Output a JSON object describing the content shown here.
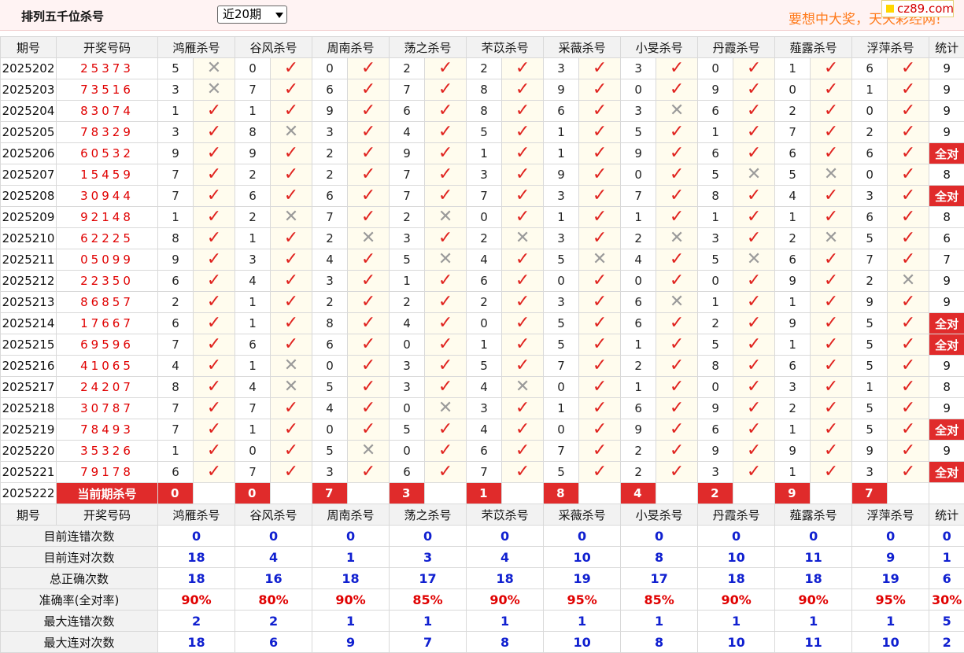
{
  "header": {
    "title": "排列五千位杀号",
    "period_select": "近20期",
    "slogan": "要想中大奖，天天彩经网!",
    "logo_text": "cz89.com"
  },
  "columns": {
    "issue": "期号",
    "draw": "开奖号码",
    "experts": [
      "鸿雁杀号",
      "谷风杀号",
      "周南杀号",
      "荡之杀号",
      "芣苡杀号",
      "采薇杀号",
      "小旻杀号",
      "丹霞杀号",
      "薤露杀号",
      "浮萍杀号"
    ],
    "total": "统计"
  },
  "rows": [
    {
      "issue": "2025202",
      "draw": "25373",
      "kills": [
        5,
        0,
        0,
        2,
        2,
        3,
        3,
        0,
        1,
        6
      ],
      "hits": [
        0,
        1,
        1,
        1,
        1,
        1,
        1,
        1,
        1,
        1
      ],
      "total": "9"
    },
    {
      "issue": "2025203",
      "draw": "73516",
      "kills": [
        3,
        7,
        6,
        7,
        8,
        9,
        0,
        9,
        0,
        1
      ],
      "hits": [
        0,
        1,
        1,
        1,
        1,
        1,
        1,
        1,
        1,
        1
      ],
      "total": "9"
    },
    {
      "issue": "2025204",
      "draw": "83074",
      "kills": [
        1,
        1,
        9,
        6,
        8,
        6,
        3,
        6,
        2,
        0
      ],
      "hits": [
        1,
        1,
        1,
        1,
        1,
        1,
        0,
        1,
        1,
        1
      ],
      "total": "9"
    },
    {
      "issue": "2025205",
      "draw": "78329",
      "kills": [
        3,
        8,
        3,
        4,
        5,
        1,
        5,
        1,
        7,
        2
      ],
      "hits": [
        1,
        0,
        1,
        1,
        1,
        1,
        1,
        1,
        1,
        1
      ],
      "total": "9"
    },
    {
      "issue": "2025206",
      "draw": "60532",
      "kills": [
        9,
        9,
        2,
        9,
        1,
        1,
        9,
        6,
        6,
        6
      ],
      "hits": [
        1,
        1,
        1,
        1,
        1,
        1,
        1,
        1,
        1,
        1
      ],
      "total": "全对"
    },
    {
      "issue": "2025207",
      "draw": "15459",
      "kills": [
        7,
        2,
        2,
        7,
        3,
        9,
        0,
        5,
        5,
        0
      ],
      "hits": [
        1,
        1,
        1,
        1,
        1,
        1,
        1,
        0,
        0,
        1
      ],
      "total": "8"
    },
    {
      "issue": "2025208",
      "draw": "30944",
      "kills": [
        7,
        6,
        6,
        7,
        7,
        3,
        7,
        8,
        4,
        3
      ],
      "hits": [
        1,
        1,
        1,
        1,
        1,
        1,
        1,
        1,
        1,
        1
      ],
      "total": "全对"
    },
    {
      "issue": "2025209",
      "draw": "92148",
      "kills": [
        1,
        2,
        7,
        2,
        0,
        1,
        1,
        1,
        1,
        6
      ],
      "hits": [
        1,
        0,
        1,
        0,
        1,
        1,
        1,
        1,
        1,
        1
      ],
      "total": "8"
    },
    {
      "issue": "2025210",
      "draw": "62225",
      "kills": [
        8,
        1,
        2,
        3,
        2,
        3,
        2,
        3,
        2,
        5
      ],
      "hits": [
        1,
        1,
        0,
        1,
        0,
        1,
        0,
        1,
        0,
        1
      ],
      "total": "6"
    },
    {
      "issue": "2025211",
      "draw": "05099",
      "kills": [
        9,
        3,
        4,
        5,
        4,
        5,
        4,
        5,
        6,
        7
      ],
      "hits": [
        1,
        1,
        1,
        0,
        1,
        0,
        1,
        0,
        1,
        1
      ],
      "total": "7"
    },
    {
      "issue": "2025212",
      "draw": "22350",
      "kills": [
        6,
        4,
        3,
        1,
        6,
        0,
        0,
        0,
        9,
        2
      ],
      "hits": [
        1,
        1,
        1,
        1,
        1,
        1,
        1,
        1,
        1,
        0
      ],
      "total": "9"
    },
    {
      "issue": "2025213",
      "draw": "86857",
      "kills": [
        2,
        1,
        2,
        2,
        2,
        3,
        6,
        1,
        1,
        9
      ],
      "hits": [
        1,
        1,
        1,
        1,
        1,
        1,
        0,
        1,
        1,
        1
      ],
      "total": "9"
    },
    {
      "issue": "2025214",
      "draw": "17667",
      "kills": [
        6,
        1,
        8,
        4,
        0,
        5,
        6,
        2,
        9,
        5
      ],
      "hits": [
        1,
        1,
        1,
        1,
        1,
        1,
        1,
        1,
        1,
        1
      ],
      "total": "全对"
    },
    {
      "issue": "2025215",
      "draw": "69596",
      "kills": [
        7,
        6,
        6,
        0,
        1,
        5,
        1,
        5,
        1,
        5
      ],
      "hits": [
        1,
        1,
        1,
        1,
        1,
        1,
        1,
        1,
        1,
        1
      ],
      "total": "全对"
    },
    {
      "issue": "2025216",
      "draw": "41065",
      "kills": [
        4,
        1,
        0,
        3,
        5,
        7,
        2,
        8,
        6,
        5
      ],
      "hits": [
        1,
        0,
        1,
        1,
        1,
        1,
        1,
        1,
        1,
        1
      ],
      "total": "9"
    },
    {
      "issue": "2025217",
      "draw": "24207",
      "kills": [
        8,
        4,
        5,
        3,
        4,
        0,
        1,
        0,
        3,
        1
      ],
      "hits": [
        1,
        0,
        1,
        1,
        0,
        1,
        1,
        1,
        1,
        1
      ],
      "total": "8"
    },
    {
      "issue": "2025218",
      "draw": "30787",
      "kills": [
        7,
        7,
        4,
        0,
        3,
        1,
        6,
        9,
        2,
        5
      ],
      "hits": [
        1,
        1,
        1,
        0,
        1,
        1,
        1,
        1,
        1,
        1
      ],
      "total": "9"
    },
    {
      "issue": "2025219",
      "draw": "78493",
      "kills": [
        7,
        1,
        0,
        5,
        4,
        0,
        9,
        6,
        1,
        5
      ],
      "hits": [
        1,
        1,
        1,
        1,
        1,
        1,
        1,
        1,
        1,
        1
      ],
      "total": "全对"
    },
    {
      "issue": "2025220",
      "draw": "35326",
      "kills": [
        1,
        0,
        5,
        0,
        6,
        7,
        2,
        9,
        9,
        9
      ],
      "hits": [
        1,
        1,
        0,
        1,
        1,
        1,
        1,
        1,
        1,
        1
      ],
      "total": "9"
    },
    {
      "issue": "2025221",
      "draw": "79178",
      "kills": [
        6,
        7,
        3,
        6,
        7,
        5,
        2,
        3,
        1,
        3
      ],
      "hits": [
        1,
        1,
        1,
        1,
        1,
        1,
        1,
        1,
        1,
        1
      ],
      "total": "全对"
    }
  ],
  "current": {
    "issue": "2025222",
    "label": "当前期杀号",
    "kills": [
      0,
      0,
      7,
      3,
      1,
      8,
      4,
      2,
      9,
      7
    ]
  },
  "stats": [
    {
      "label": "目前连错次数",
      "values": [
        "0",
        "0",
        "0",
        "0",
        "0",
        "0",
        "0",
        "0",
        "0",
        "0"
      ],
      "total": "0"
    },
    {
      "label": "目前连对次数",
      "values": [
        "18",
        "4",
        "1",
        "3",
        "4",
        "10",
        "8",
        "10",
        "11",
        "9"
      ],
      "total": "1"
    },
    {
      "label": "总正确次数",
      "values": [
        "18",
        "16",
        "18",
        "17",
        "18",
        "19",
        "17",
        "18",
        "18",
        "19"
      ],
      "total": "6"
    },
    {
      "label": "准确率(全对率)",
      "values": [
        "90%",
        "80%",
        "90%",
        "85%",
        "90%",
        "95%",
        "85%",
        "90%",
        "90%",
        "95%"
      ],
      "total": "30%",
      "red": true
    },
    {
      "label": "最大连错次数",
      "values": [
        "2",
        "2",
        "1",
        "1",
        "1",
        "1",
        "1",
        "1",
        "1",
        "1"
      ],
      "total": "5"
    },
    {
      "label": "最大连对次数",
      "values": [
        "18",
        "6",
        "9",
        "7",
        "8",
        "10",
        "8",
        "10",
        "11",
        "10"
      ],
      "total": "2"
    }
  ],
  "glyphs": {
    "hit": "✓",
    "miss": "✕"
  },
  "colors": {
    "accent": "#e02b2b",
    "stat_blue": "#1020d0",
    "draw_red": "#e00000",
    "slogan": "#ff7a1a"
  }
}
